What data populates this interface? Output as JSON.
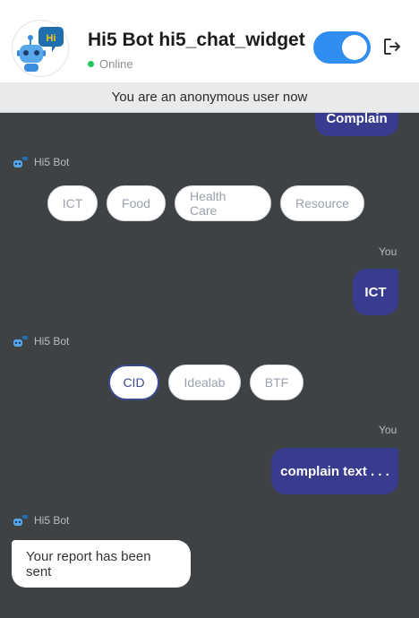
{
  "header": {
    "title": "Hi5 Bot hi5_chat_widget",
    "status": "Online",
    "avatar_badge": "Hi",
    "toggle_on": true
  },
  "banner": {
    "text": "You are an anonymous user now"
  },
  "messages": {
    "partial_user": "Complain",
    "bot1_sender": "Hi5 Bot",
    "options1": [
      "ICT",
      "Food",
      "Health Care",
      "Resource"
    ],
    "you1": "You",
    "user1": "ICT",
    "bot2_sender": "Hi5 Bot",
    "options2": [
      "CID",
      "Idealab",
      "BTF"
    ],
    "you2": "You",
    "user2": "complain text . . .",
    "bot3_sender": "Hi5 Bot",
    "bot3_text": "Your report has been sent"
  },
  "colors": {
    "user_bubble": "#373c8f",
    "chat_bg": "#3f4245",
    "toggle": "#2f8ef0",
    "online": "#22c55e"
  }
}
